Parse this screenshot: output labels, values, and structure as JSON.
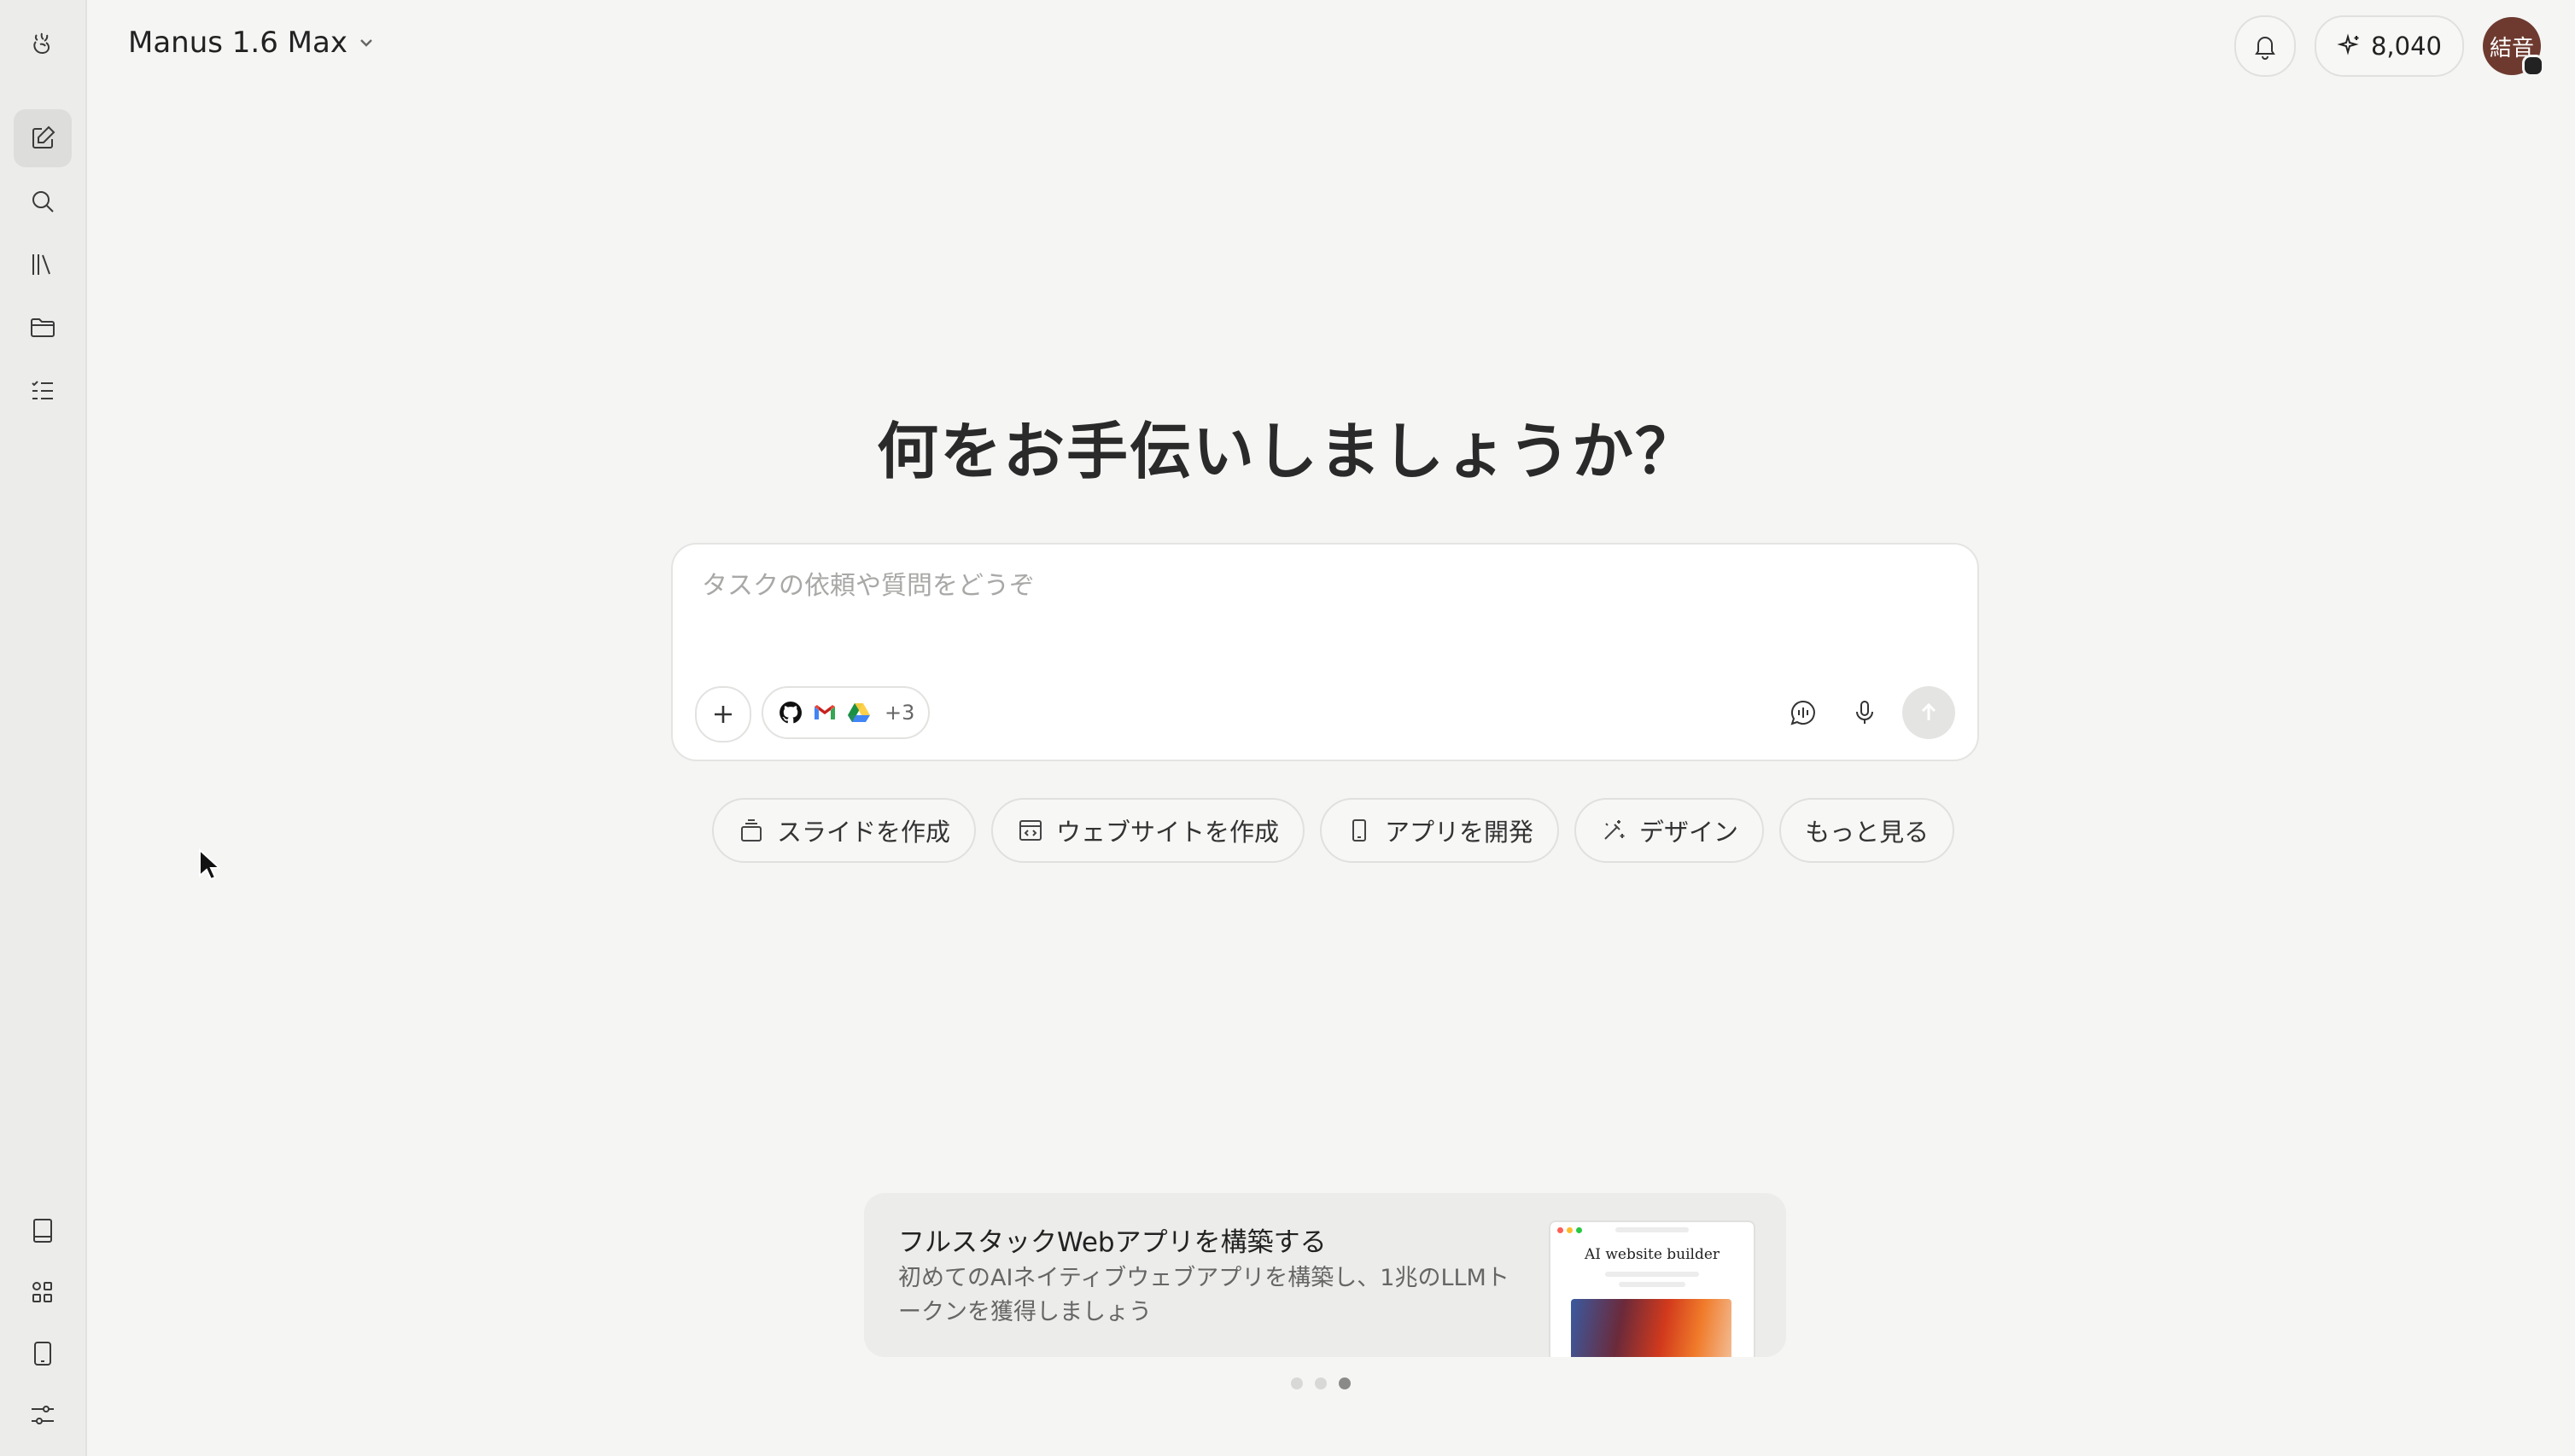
{
  "header": {
    "model_label": "Manus 1.6 Max",
    "credits": "8,040",
    "avatar_text": "結音"
  },
  "main": {
    "headline": "何をお手伝いしましょうか？",
    "composer": {
      "placeholder": "タスクの依頼や質問をどうぞ",
      "connectors_more": "+3"
    },
    "chips": [
      {
        "label": "スライドを作成",
        "icon": "slides-icon"
      },
      {
        "label": "ウェブサイトを作成",
        "icon": "website-icon"
      },
      {
        "label": "アプリを開発",
        "icon": "phone-icon"
      },
      {
        "label": "デザイン",
        "icon": "design-icon"
      },
      {
        "label": "もっと見る",
        "icon": ""
      }
    ]
  },
  "promo": {
    "title": "フルスタックWebアプリを構築する",
    "description": "初めてのAIネイティブウェブアプリを構築し、1兆のLLMトークンを獲得しましょう",
    "thumb_title": "AI website builder",
    "pager_active": 3,
    "pager_count": 3
  },
  "sidebar": {
    "top_items": [
      "new-task-icon",
      "search-icon",
      "library-icon",
      "folder-icon",
      "tasks-icon"
    ],
    "bottom_items": [
      "book-icon",
      "apps-icon",
      "tablet-icon",
      "settings-icon"
    ]
  },
  "colors": {
    "background": "#f5f5f4",
    "sidebar": "#ececeb",
    "avatar": "#6e3a2f"
  }
}
